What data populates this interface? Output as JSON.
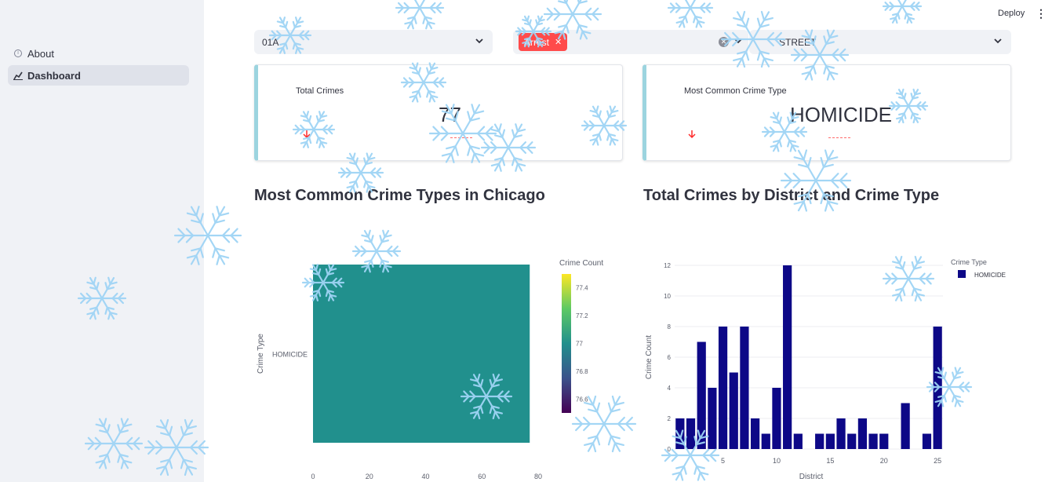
{
  "sidebar": {
    "items": [
      {
        "label": "About",
        "icon": "info-circle-icon"
      },
      {
        "label": "Dashboard",
        "icon": "chart-icon"
      }
    ]
  },
  "toolbar": {
    "deploy_label": "Deploy",
    "menu_icon": "kebab-menu-icon"
  },
  "filters": {
    "beat": {
      "value": "01A"
    },
    "arrest": {
      "tag": "Arrest"
    },
    "location": {
      "value": "STREET"
    }
  },
  "metrics": {
    "total": {
      "label": "Total Crimes",
      "value": "77",
      "delta_icon": "down-arrow-icon"
    },
    "common": {
      "label": "Most Common Crime Type",
      "value": "HOMICIDE",
      "delta_icon": "down-arrow-icon"
    }
  },
  "sections": {
    "heatmap_title": "Most Common Crime Types in Chicago",
    "bar_title": "Total Crimes by District and Crime Type"
  },
  "colors": {
    "accent": "#ff4b4b",
    "heatmap_cell": "#21908d",
    "bar": "#0d0887",
    "card_border": "#9cd4df"
  },
  "chart_data": [
    {
      "type": "heatmap",
      "title": "",
      "xlabel": "",
      "ylabel": "Crime Type",
      "y_categories": [
        "HOMICIDE"
      ],
      "x_ticks": [
        0,
        20,
        40,
        60,
        80
      ],
      "xlim": [
        0,
        80
      ],
      "cells": [
        {
          "x_range": [
            0,
            77
          ],
          "y": "HOMICIDE",
          "value": 77
        }
      ],
      "colorbar": {
        "title": "Crime Count",
        "ticks": [
          76.6,
          76.8,
          77,
          77.2,
          77.4
        ],
        "range": [
          76.5,
          77.5
        ],
        "colorscale": "viridis"
      }
    },
    {
      "type": "bar",
      "title": "",
      "xlabel": "District",
      "ylabel": "Crime Count",
      "x": [
        1,
        2,
        3,
        4,
        5,
        6,
        7,
        8,
        9,
        10,
        11,
        12,
        14,
        15,
        16,
        17,
        18,
        19,
        20,
        22,
        24,
        25
      ],
      "series": [
        {
          "name": "HOMICIDE",
          "values": [
            2,
            2,
            7,
            4,
            8,
            5,
            8,
            2,
            1,
            4,
            12,
            1,
            1,
            1,
            2,
            1,
            2,
            1,
            1,
            3,
            1,
            8
          ]
        }
      ],
      "x_ticks": [
        5,
        10,
        15,
        20,
        25
      ],
      "y_ticks": [
        0,
        2,
        4,
        6,
        8,
        10,
        12
      ],
      "xlim": [
        0.5,
        25.5
      ],
      "ylim": [
        0,
        12
      ],
      "legend": {
        "title": "Crime Type",
        "placement": "top-right"
      }
    }
  ]
}
